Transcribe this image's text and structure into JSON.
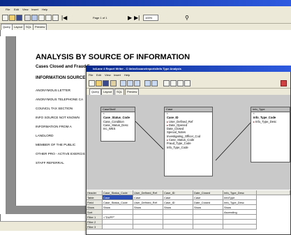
{
  "back_window": {
    "title": "loiLane 4 Report Writer - C:\\intec\\locane\\reports\\Info Type Analysis",
    "menu": [
      "File",
      "Edit",
      "View",
      "Insert",
      "Help"
    ],
    "toolbar": {
      "page_label": "Page 1 of 1",
      "zoom_value": "100%"
    },
    "tabs": [
      "Query",
      "Layout",
      "SQL",
      "Preview"
    ]
  },
  "report": {
    "title": "ANALYSIS BY SOURCE OF INFORMATION",
    "subtitle": "Cases Closed and Fraud F",
    "section_heading": "INFORMATION SOURCE",
    "items": [
      "ANONYMOUS  LETTER",
      "ANONYMOUS TELEPHONE CA",
      "COUNCIL TAX SECTION",
      "INFO SOURCE NOT KNOWN",
      "INFORMATION FROM A",
      "LANDLORD",
      "MEMBER OF THE PUBLIC",
      "OTHER PRO - ACTIVE EXERCIS",
      "STAFF REFERRAL"
    ]
  },
  "front_window": {
    "title": "loiLane 4 Report Writer - C:\\intec\\locane\\reports\\Info Type Analysis",
    "menu": [
      "File",
      "Edit",
      "View",
      "Insert",
      "Help"
    ],
    "tabs": [
      "Query",
      "Layout",
      "SQL",
      "Preview"
    ]
  },
  "tables": {
    "caseshelf": {
      "name": "CaseShelf",
      "fields": [
        "*",
        "Case_Status_Code",
        "Case_Condition",
        "Case_Status_Desc",
        "Inc_WES"
      ]
    },
    "case": {
      "name": "Case",
      "fields": [
        "*",
        "Case_ID",
        "User_Defined_Ref",
        "Date_Opened",
        "Date_Closed",
        "Special_Notes",
        "Investigating_Officer_Cod",
        "Case_Status_Code",
        "Fraud_Type_Code",
        "Info_Type_Code"
      ]
    },
    "info_type": {
      "name": "Info_Type",
      "fields": [
        "*",
        "Info_Type_Code",
        "Info_Type_Desc"
      ]
    }
  },
  "grid": {
    "row_headers": [
      "Header",
      "Table",
      "Field",
      "Show",
      "Sort",
      "Filter 1",
      "Filter 2",
      "Filter 3"
    ],
    "columns": [
      {
        "header": "Case_Status_Code",
        "table": "Case",
        "field": "Case_Status_Code",
        "show": "Show",
        "sort": "",
        "filter1": "<\"DUPP\""
      },
      {
        "header": "User_Defined_Ref",
        "table": "Case",
        "field": "User_Defined_Ref",
        "show": "Show",
        "sort": "",
        "filter1": ""
      },
      {
        "header": "Case_ID",
        "table": "Case",
        "field": "Case_ID",
        "show": "Show",
        "sort": "",
        "filter1": ""
      },
      {
        "header": "Date_Closed",
        "table": "Case",
        "field": "Date_Closed",
        "show": "Show",
        "sort": "",
        "filter1": ""
      },
      {
        "header": "Info_Type_Desc",
        "table": "InfoType",
        "field": "Info_Type_Desc",
        "show": "Show",
        "sort": "Ascending",
        "filter1": ""
      }
    ]
  }
}
